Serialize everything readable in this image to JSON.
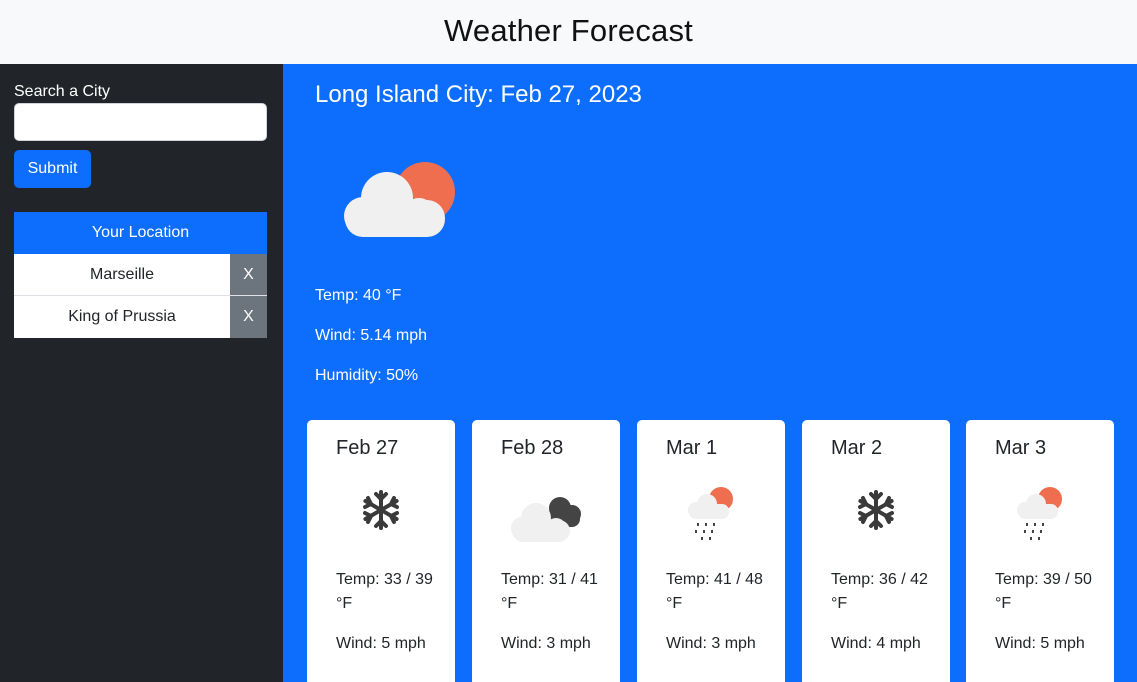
{
  "header": {
    "title": "Weather Forecast"
  },
  "sidebar": {
    "search_label": "Search a City",
    "search_value": "",
    "submit_label": "Submit",
    "locations_header": "Your Location",
    "locations": [
      {
        "name": "Marseille",
        "remove": "X"
      },
      {
        "name": "King of Prussia",
        "remove": "X"
      }
    ]
  },
  "current": {
    "title": "Long Island City: Feb 27, 2023",
    "icon": "partly-cloudy-sun-icon",
    "temp": "Temp: 40 °F",
    "wind": "Wind: 5.14 mph",
    "humidity": "Humidity: 50%"
  },
  "forecast": [
    {
      "date": "Feb 27",
      "icon": "snow-icon",
      "temp": "Temp: 33 / 39 °F",
      "wind": "Wind: 5 mph"
    },
    {
      "date": "Feb 28",
      "icon": "cloudy-night-icon",
      "temp": "Temp: 31 / 41 °F",
      "wind": "Wind: 3 mph"
    },
    {
      "date": "Mar 1",
      "icon": "rain-sun-icon",
      "temp": "Temp: 41 / 48 °F",
      "wind": "Wind: 3 mph"
    },
    {
      "date": "Mar 2",
      "icon": "snow-icon",
      "temp": "Temp: 36 / 42 °F",
      "wind": "Wind: 4 mph"
    },
    {
      "date": "Mar 3",
      "icon": "rain-sun-icon",
      "temp": "Temp: 39 / 50 °F",
      "wind": "Wind: 5 mph"
    }
  ],
  "colors": {
    "primary": "#0d6efd",
    "sidebar_bg": "#212529",
    "remove_bg": "#6c757d",
    "sun": "#ee6e4f",
    "cloud": "#f0f0f0",
    "dark_cloud": "#444444"
  }
}
